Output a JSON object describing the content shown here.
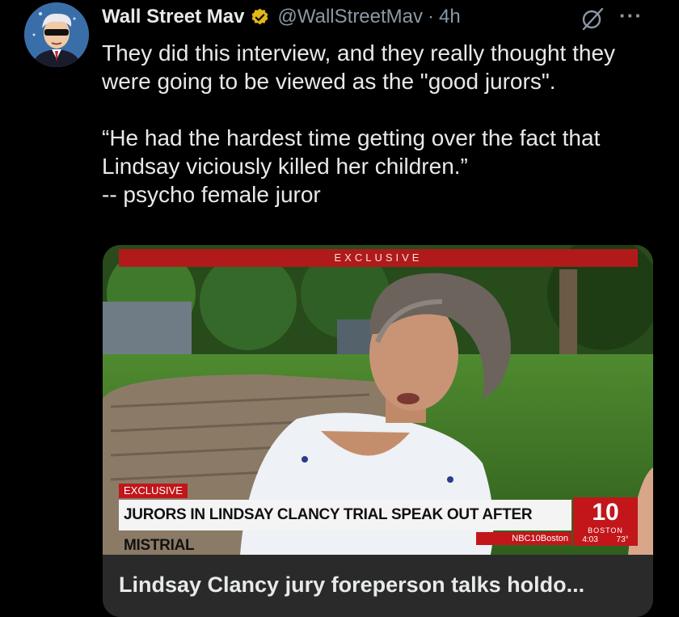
{
  "tweet": {
    "author": {
      "display_name": "Wall Street Mav",
      "handle": "@WallStreetMav",
      "verified_color": "#e2b719"
    },
    "separator": "·",
    "time": "4h",
    "text_lines": [
      "They did this interview, and they really thought they",
      "were going to be viewed as the \"good jurors\".",
      "",
      "“He had the hardest time getting over the fact that",
      "Lindsay viciously killed her children.”",
      "-- psycho female juror"
    ]
  },
  "media": {
    "top_banner": "EXCLUSIVE",
    "tag": "EXCLUSIVE",
    "headline": "JURORS IN LINDSAY CLANCY TRIAL SPEAK OUT AFTER MISTRIAL",
    "social": "NBC10Boston",
    "station_number": "10",
    "station_city": "BOSTON",
    "clock": "4:03",
    "temperature": "73°",
    "accent_color": "#c2161b"
  },
  "link_card": {
    "title": "Lindsay Clancy jury foreperson talks holdo..."
  },
  "icons": [
    "avatar",
    "verified-badge-icon",
    "grok-icon",
    "more-icon"
  ]
}
